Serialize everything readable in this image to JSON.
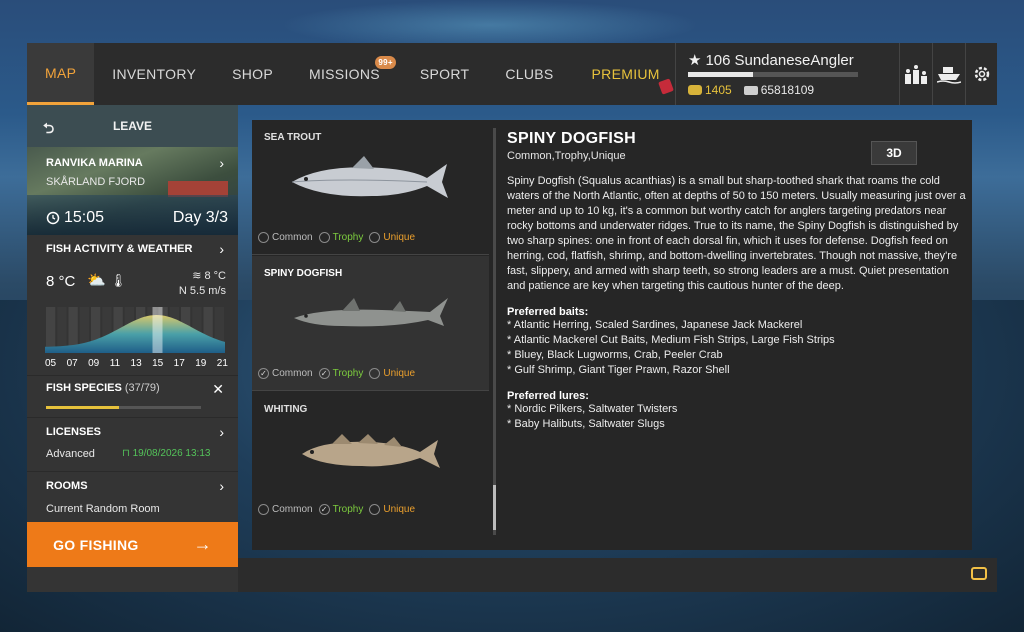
{
  "nav": {
    "tabs": [
      {
        "label": "MAP",
        "active": true
      },
      {
        "label": "INVENTORY"
      },
      {
        "label": "SHOP"
      },
      {
        "label": "MISSIONS",
        "badge": "99+"
      },
      {
        "label": "SPORT"
      },
      {
        "label": "CLUBS"
      },
      {
        "label": "PREMIUM"
      }
    ]
  },
  "player": {
    "level": "106",
    "name": "SundaneseAngler",
    "xp_fraction": 0.38,
    "gold": "1405",
    "silver": "65818109"
  },
  "icons": {
    "leaderboard": "podium-icon",
    "boat": "boat-icon",
    "settings": "gear-icon",
    "chat": "chat-icon"
  },
  "sidebar": {
    "leave": "LEAVE",
    "location": {
      "name": "RANVIKA MARINA",
      "region": "SKÅRLAND FJORD",
      "time": "15:05",
      "day": "Day 3/3"
    },
    "weather": {
      "title": "FISH ACTIVITY & WEATHER",
      "air_temp": "8 °C",
      "water_temp": "8 °C",
      "wind": "N 5.5 m/s",
      "hours": [
        "05",
        "07",
        "09",
        "11",
        "13",
        "15",
        "17",
        "19",
        "21"
      ],
      "current_hour": "15"
    },
    "species": {
      "title": "FISH SPECIES",
      "count": "(37/79)",
      "progress": 0.468
    },
    "licenses": {
      "title": "LICENSES",
      "type": "Advanced",
      "expiry": "19/08/2026 13:13"
    },
    "rooms": {
      "title": "ROOMS",
      "value": "Current Random Room"
    },
    "go_fishing": "GO FISHING"
  },
  "fish_list": [
    {
      "name": "SEA TROUT",
      "options": [
        {
          "label": "Common",
          "checked": false
        },
        {
          "label": "Trophy",
          "checked": false
        },
        {
          "label": "Unique",
          "checked": false
        }
      ]
    },
    {
      "name": "SPINY DOGFISH",
      "selected": true,
      "options": [
        {
          "label": "Common",
          "checked": true
        },
        {
          "label": "Trophy",
          "checked": true
        },
        {
          "label": "Unique",
          "checked": false
        }
      ]
    },
    {
      "name": "WHITING",
      "options": [
        {
          "label": "Common",
          "checked": false
        },
        {
          "label": "Trophy",
          "checked": true
        },
        {
          "label": "Unique",
          "checked": false
        }
      ]
    }
  ],
  "detail": {
    "title": "SPINY DOGFISH",
    "subtitle": "Common,Trophy,Unique",
    "btn_3d": "3D",
    "description": "Spiny Dogfish (Squalus acanthias) is a small but sharp-toothed shark that roams the cold waters of the North Atlantic, often at depths of 50 to 150 meters. Usually measuring just over a meter and up to 10 kg, it's a common but worthy catch for anglers targeting predators near rocky bottoms and underwater ridges. True to its name, the Spiny Dogfish is distinguished by two sharp spines: one in front of each dorsal fin, which it uses for defense. Dogfish feed on herring, cod, flatfish, shrimp, and bottom-dwelling invertebrates. Though not massive, they're fast, slippery, and armed with sharp teeth, so strong leaders are a must. Quiet presentation and patience are key when targeting this cautious hunter of the deep.",
    "baits_title": "Preferred baits:",
    "baits": [
      "* Atlantic Herring, Scaled Sardines, Japanese Jack Mackerel",
      "* Atlantic Mackerel Cut Baits, Medium Fish Strips, Large Fish Strips",
      "* Bluey, Black Lugworms, Crab, Peeler Crab",
      "* Gulf Shrimp, Giant Tiger Prawn, Razor Shell"
    ],
    "lures_title": "Preferred lures:",
    "lures": [
      "* Nordic Pilkers, Saltwater Twisters",
      "* Baby Halibuts, Saltwater Slugs"
    ]
  },
  "colors": {
    "accent": "#f2a33a",
    "go_fishing": "#ee7a18",
    "trophy": "#7ccb3e",
    "unique": "#ea9f2d",
    "license_valid": "#54c35a"
  }
}
